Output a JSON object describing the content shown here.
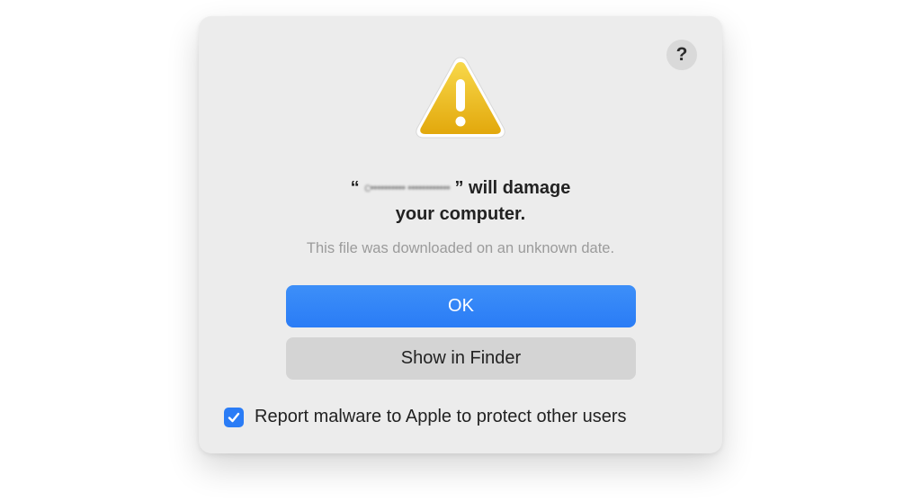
{
  "dialog": {
    "help_label": "?",
    "title_open_quote": "“",
    "title_filename_redacted": "c•••••••••• ••••••••••••",
    "title_close": "” will damage",
    "title_line2": "your computer.",
    "subtitle": "This file was downloaded on an unknown date.",
    "ok_label": "OK",
    "show_in_finder_label": "Show in Finder",
    "report_checkbox": {
      "label": "Report malware to Apple to protect other users",
      "checked": true
    }
  },
  "icons": {
    "warning": "warning-triangle-icon",
    "checkmark": "checkmark-icon"
  },
  "colors": {
    "accent": "#2a7cf6",
    "warning_yellow": "#f2c318",
    "dialog_bg": "#ececec",
    "secondary_button": "#d4d4d4"
  }
}
